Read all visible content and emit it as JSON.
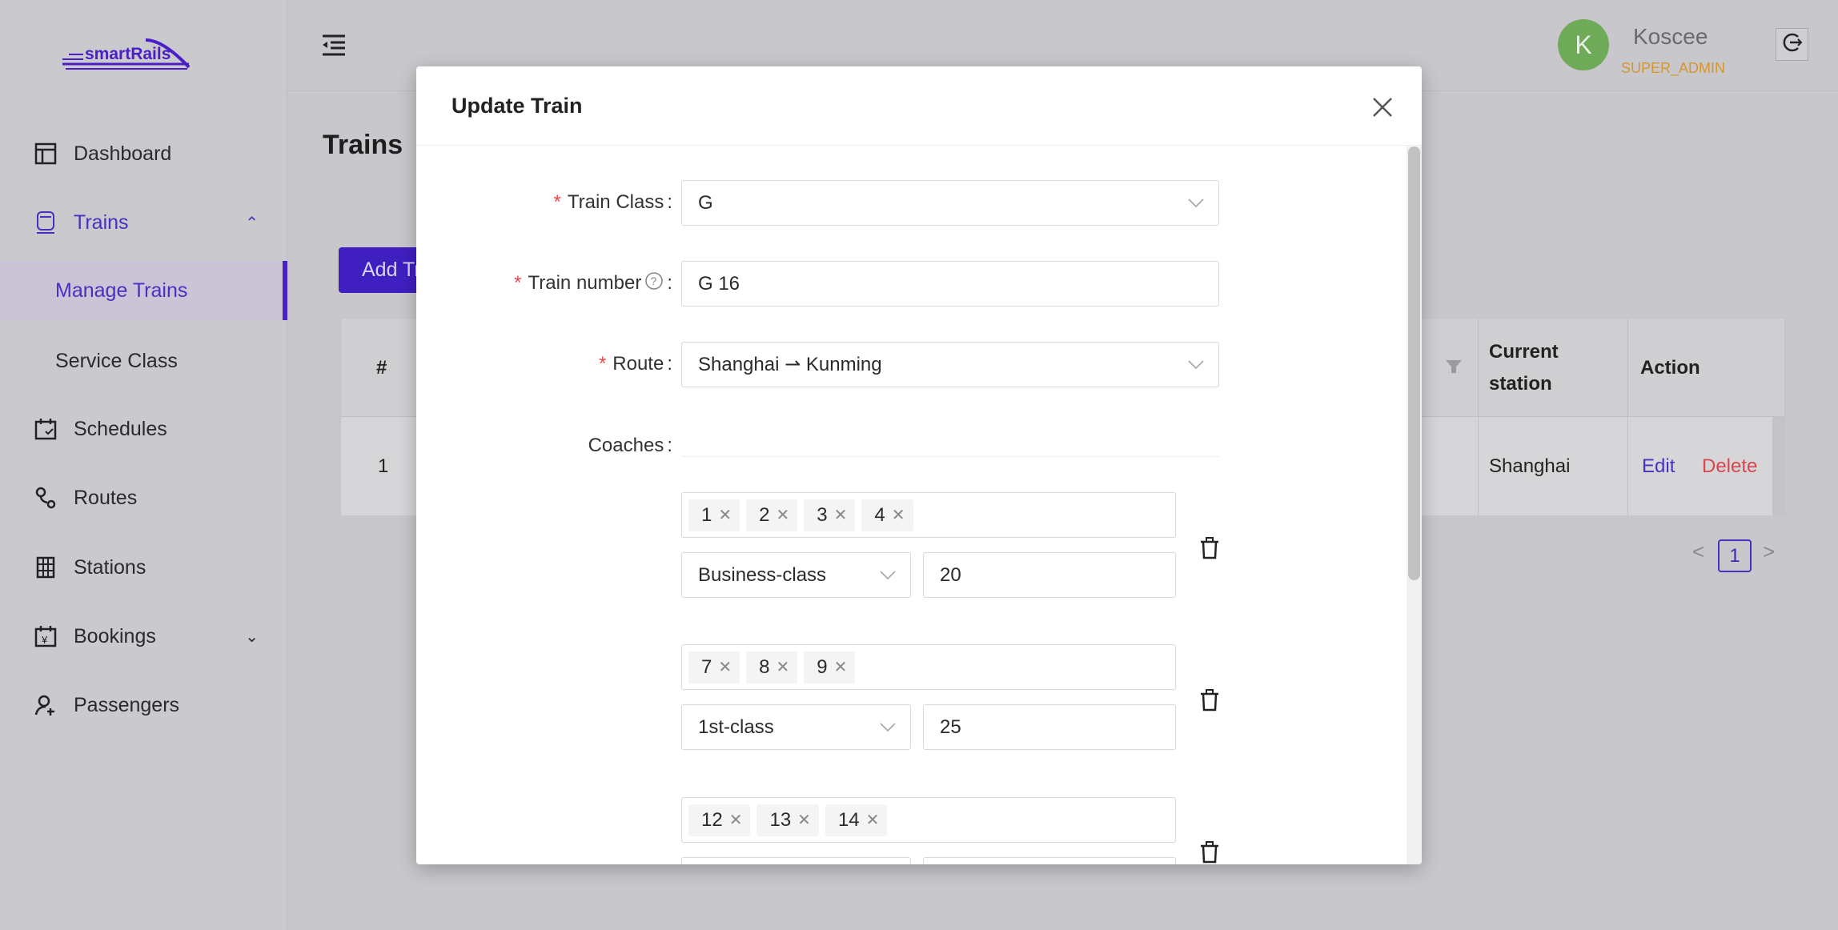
{
  "app": {
    "logo_text": "smartRails",
    "brand_color": "#4a1fc8"
  },
  "sidebar": {
    "items": [
      {
        "label": "Dashboard",
        "icon": "layout-icon"
      },
      {
        "label": "Trains",
        "icon": "train-icon",
        "expanded": true
      },
      {
        "label": "Manage Trains",
        "selected": true
      },
      {
        "label": "Service Class"
      },
      {
        "label": "Schedules",
        "icon": "calendar-check-icon"
      },
      {
        "label": "Routes",
        "icon": "route-icon"
      },
      {
        "label": "Stations",
        "icon": "building-icon"
      },
      {
        "label": "Bookings",
        "icon": "calendar-yen-icon",
        "expanded": false
      },
      {
        "label": "Passengers",
        "icon": "user-add-icon"
      }
    ]
  },
  "header": {
    "user": {
      "initial": "K",
      "name": "Koscee",
      "role": "SUPER_ADMIN"
    }
  },
  "main": {
    "title": "Trains",
    "add_button": "Add Train",
    "table": {
      "columns": [
        "#",
        "Current station",
        "Action"
      ],
      "rows": [
        {
          "index": "1",
          "current_station": "Shanghai",
          "actions": [
            "Edit",
            "Delete"
          ]
        }
      ]
    },
    "pagination": {
      "current": "1",
      "prev": "<",
      "next": ">"
    }
  },
  "modal": {
    "title": "Update Train",
    "fields": {
      "train_class": {
        "label": "Train Class",
        "value": "G"
      },
      "train_number": {
        "label": "Train number",
        "value": "G 16"
      },
      "route": {
        "label": "Route",
        "value": "Shanghai ⇀ Kunming"
      },
      "coaches": {
        "label": "Coaches"
      }
    },
    "coach_groups": [
      {
        "coaches": [
          "1",
          "2",
          "3",
          "4"
        ],
        "class": "Business-class",
        "seats": "20"
      },
      {
        "coaches": [
          "7",
          "8",
          "9"
        ],
        "class": "1st-class",
        "seats": "25"
      },
      {
        "coaches": [
          "12",
          "13",
          "14"
        ],
        "class": "",
        "seats": ""
      }
    ]
  }
}
